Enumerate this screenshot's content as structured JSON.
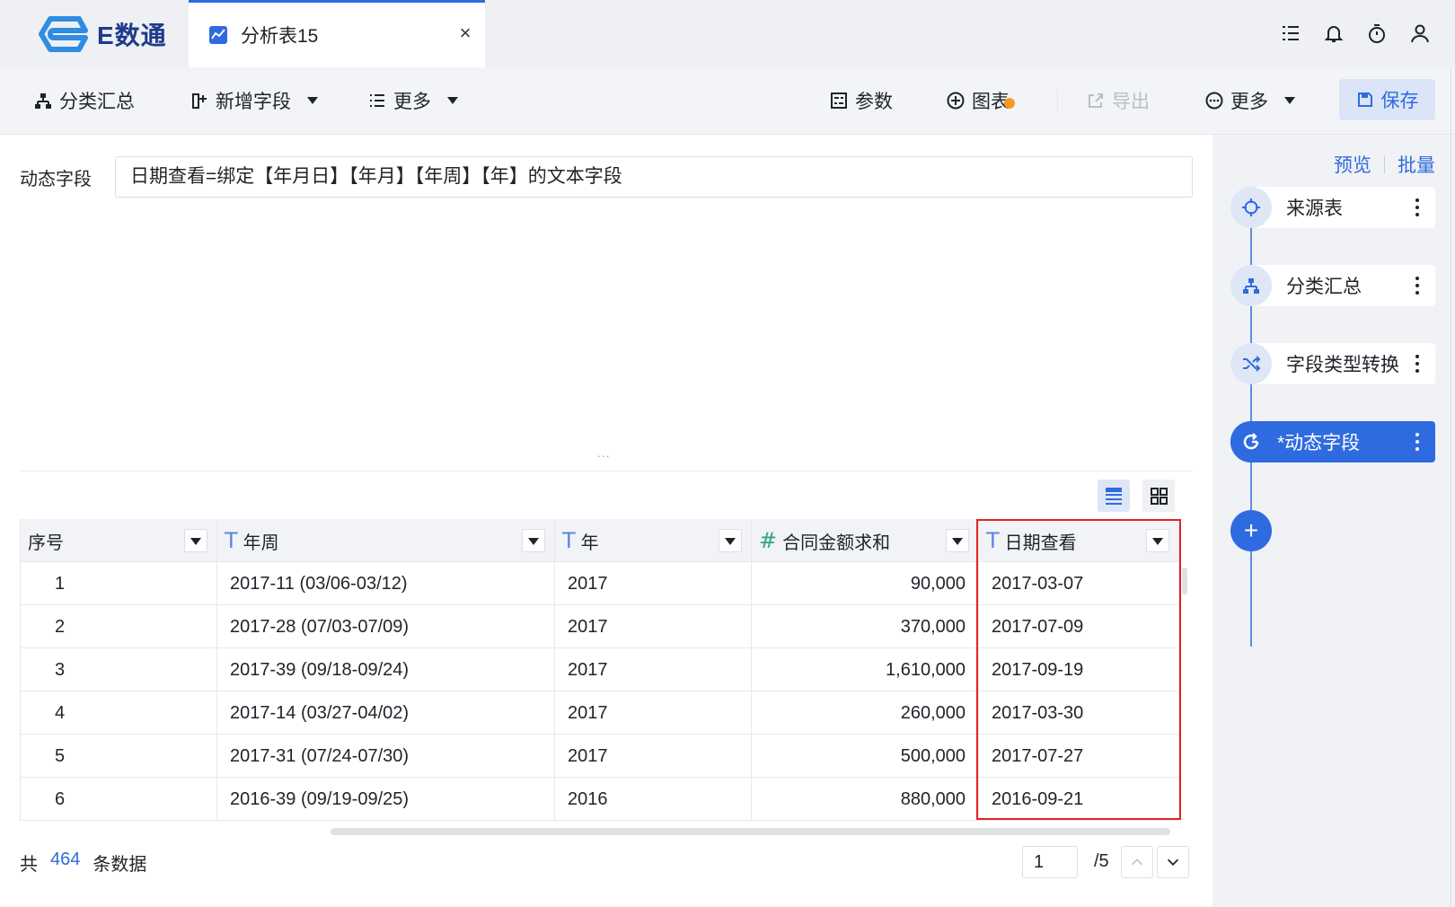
{
  "app": {
    "brand": "E数通"
  },
  "tab": {
    "label": "分析表15",
    "close": "×"
  },
  "toolbar": {
    "group_summary": "分类汇总",
    "add_field": "新增字段",
    "more_left": "更多",
    "params": "参数",
    "chart": "图表",
    "export": "导出",
    "more_right": "更多",
    "save": "保存"
  },
  "dynamic_field": {
    "label": "动态字段",
    "expression": "日期查看=绑定【年月日】【年月】【年周】【年】的文本字段"
  },
  "splitter": "...",
  "table": {
    "columns": [
      {
        "type": "",
        "label": "序号"
      },
      {
        "type": "T",
        "label": "年周"
      },
      {
        "type": "T",
        "label": "年"
      },
      {
        "type": "#",
        "label": "合同金额求和"
      },
      {
        "type": "T",
        "label": "日期查看"
      }
    ],
    "rows": [
      [
        "1",
        "2017-11 (03/06-03/12)",
        "2017",
        "90,000",
        "2017-03-07"
      ],
      [
        "2",
        "2017-28 (07/03-07/09)",
        "2017",
        "370,000",
        "2017-07-09"
      ],
      [
        "3",
        "2017-39 (09/18-09/24)",
        "2017",
        "1,610,000",
        "2017-09-19"
      ],
      [
        "4",
        "2017-14 (03/27-04/02)",
        "2017",
        "260,000",
        "2017-03-30"
      ],
      [
        "5",
        "2017-31 (07/24-07/30)",
        "2017",
        "500,000",
        "2017-07-27"
      ],
      [
        "6",
        "2016-39 (09/19-09/25)",
        "2016",
        "880,000",
        "2016-09-21"
      ]
    ]
  },
  "footer": {
    "prefix": "共",
    "count": "464",
    "suffix": "条数据",
    "page": "1",
    "total_pages": "/5"
  },
  "flow": {
    "preview": "预览",
    "batch": "批量",
    "steps": [
      {
        "label": "来源表",
        "icon": "crosshair-icon"
      },
      {
        "label": "分类汇总",
        "icon": "hierarchy-icon"
      },
      {
        "label": "字段类型转换",
        "icon": "shuffle-icon"
      },
      {
        "label": "*动态字段",
        "icon": "refresh-icon"
      }
    ],
    "add": "+"
  },
  "colors": {
    "accent": "#2f6be0",
    "highlight": "#e02424",
    "badge": "#f59a23"
  }
}
